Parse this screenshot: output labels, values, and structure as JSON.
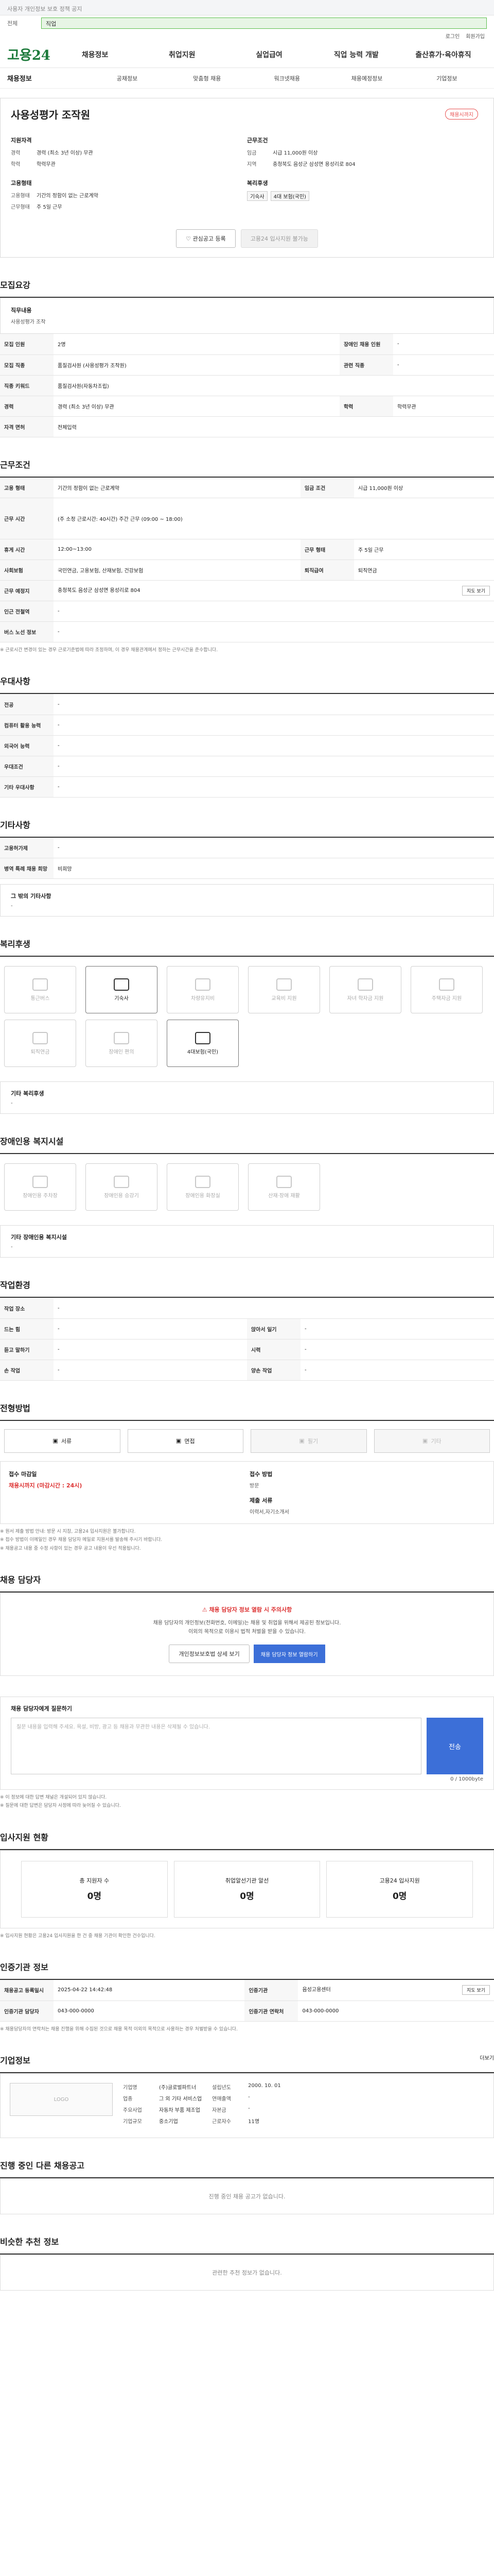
{
  "top": {
    "notice": "사용자 개인정보 보호 정책 공지",
    "search_scope": "전체",
    "search_placeholder": "직업",
    "util": [
      "로그인",
      "회원가입"
    ]
  },
  "gnb": {
    "logo": "고용24",
    "items": [
      "채용정보",
      "취업지원",
      "실업급여",
      "직업 능력 개발",
      "출산휴가·육아휴직"
    ]
  },
  "lnb": {
    "items": [
      "채용정보",
      "공채정보",
      "맞춤형 채용",
      "워크넷채용",
      "채용예정정보",
      "기업정보"
    ]
  },
  "summary": {
    "title": "사용성평가 조작원",
    "badge": "채용시까지",
    "col1_title": "지원자격",
    "col1": [
      {
        "k": "경력",
        "v": "경력 (최소 3년 이상) 무관"
      },
      {
        "k": "학력",
        "v": "학력무관"
      }
    ],
    "col2_title": "근무조건",
    "col2": [
      {
        "k": "임금",
        "v": "시급 11,000원 이상"
      },
      {
        "k": "지역",
        "v": "충청북도 음성군 삼성면 용성리로 804"
      }
    ],
    "col3_title": "고용형태",
    "col3": [
      {
        "k": "고용형태",
        "v": "기간의 정함이 없는 근로계약"
      },
      {
        "k": "근무형태",
        "v": "주 5일 근무"
      }
    ],
    "col4_title": "복리후생",
    "col4_tags": [
      "기숙사",
      "4대 보험(국민)"
    ],
    "btn_interest": "관심공고 등록",
    "btn_apply": "고용24 입사지원 불가능"
  },
  "s1": {
    "title": "모집요강",
    "job_label": "직무내용",
    "job_text": "사용성평가 조작"
  },
  "t1": [
    [
      "모집 인원",
      "2명",
      "장애인 채용 인원",
      "-"
    ],
    [
      "모집 직종",
      "품질검사원 (사용성평가 조작원)",
      "관련 직종",
      "-"
    ],
    [
      "직종 키워드",
      "품질검사원(자동차조립)",
      "",
      ""
    ],
    [
      "경력",
      "경력 (최소 3년 이상) 무관",
      "학력",
      "학력무관"
    ],
    [
      "자격 면허",
      "전체입력",
      "",
      ""
    ]
  ],
  "s2": {
    "title": "근무조건",
    "detail_btn": "지도 보기",
    "note": "※ 근로시간 변경이 있는 경우 근로기준법에 따라 조정하며, 이 경우 채용관계에서 정하는 근무시간을 준수합니다."
  },
  "t2": [
    [
      "고용 형태",
      "기간의 정함이 없는 근로계약",
      "임금 조건",
      "시급 11,000원 이상"
    ],
    [
      "근무 시간",
      "(주 소정 근로시간: 40시간) 주간 근무 (09:00 ~ 18:00)",
      "",
      ""
    ],
    [
      "휴게 시간",
      "12:00~13:00",
      "근무 형태",
      "주 5일 근무"
    ],
    [
      "사회보험",
      "국민연금, 고용보험, 산재보험, 건강보험",
      "퇴직급여",
      "퇴직연금"
    ],
    [
      "근무 예정지",
      "충청북도 음성군 삼성면 용성리로 804",
      "",
      ""
    ],
    [
      "인근 전철역",
      "-",
      "",
      ""
    ],
    [
      "버스 노선 정보",
      "-",
      "",
      ""
    ]
  ],
  "s3": {
    "title": "우대사항"
  },
  "t3": [
    [
      "전공",
      "-"
    ],
    [
      "컴퓨터 활용 능력",
      "-"
    ],
    [
      "외국어 능력",
      "-"
    ],
    [
      "우대조건",
      "-"
    ],
    [
      "기타 우대사항",
      "-"
    ]
  ],
  "s4": {
    "title": "기타사항"
  },
  "t4": [
    [
      "고용허가제",
      "-"
    ],
    [
      "병역 특례 채용 희망",
      "비희망"
    ]
  ],
  "s4b": {
    "label": "그 밖의 기타사항",
    "text": "-"
  },
  "s5": {
    "title": "복리후생",
    "icons": [
      {
        "label": "통근버스",
        "on": false
      },
      {
        "label": "기숙사",
        "on": true
      },
      {
        "label": "차량유지비",
        "on": false
      },
      {
        "label": "교육비 지원",
        "on": false
      },
      {
        "label": "자녀 학자금 지원",
        "on": false
      },
      {
        "label": "주택자금 지원",
        "on": false
      },
      {
        "label": "퇴직연금",
        "on": false
      },
      {
        "label": "장애인 편의",
        "on": false
      },
      {
        "label": "4대보험(국민)",
        "on": true
      }
    ],
    "etc_label": "기타 복리후생",
    "etc_text": "-"
  },
  "s6": {
    "title": "장애인용 복지시설",
    "icons": [
      "장애인용 주차장",
      "장애인용 승강기",
      "장애인용 화장실",
      "산재·장애 재활"
    ],
    "etc_label": "기타 장애인용 복지시설",
    "etc_text": "-"
  },
  "s7": {
    "title": "작업환경"
  },
  "t7": [
    [
      "작업 장소",
      "-",
      "",
      ""
    ],
    [
      "드는 힘",
      "-",
      "앉아서 일기",
      "-"
    ],
    [
      "듣고 말하기",
      "-",
      "시력",
      "-"
    ],
    [
      "손 작업",
      "-",
      "양손 작업",
      "-"
    ]
  ],
  "s8": {
    "title": "전형방법",
    "methods": [
      {
        "label": "서류",
        "on": true
      },
      {
        "label": "면접",
        "on": true
      },
      {
        "label": "필기",
        "on": false
      },
      {
        "label": "기타",
        "on": false
      }
    ],
    "deadline_label": "접수 마감일",
    "deadline": "채용시까지 (마감시간 : 24시)",
    "method_label": "접수 방법",
    "method_val": "방문",
    "docs_label": "제출 서류",
    "docs_val": "이력서,자기소개서",
    "notes": [
      "※ 원서 제출 방법 안내: 방문 시 지참, 고용24 입사지원은 불가합니다.",
      "※ 접수 방법이 이메일인 경우 채용 담당자 메일로 지원서를 발송해 주시기 바랍니다.",
      "※ 채용공고 내용 중 수정 사항이 있는 경우 공고 내용이 우선 적용됩니다."
    ]
  },
  "s9": {
    "title": "채용 담당자",
    "alert": "채용 담당자 정보 열람 시 주의사항",
    "p1": "채용 담당자의 개인정보(전화번호, 이메일)는 채용 및 취업을 위해서 제공된 정보입니다.",
    "p2": "이외의 목적으로 이용시 법적 처벌을 받을 수 있습니다.",
    "btn1": "개인정보보호법 상세 보기",
    "btn2": "채용 담당자 정보 열람하기"
  },
  "s10": {
    "title": "채용 담당자에게 질문하기",
    "count": "0 / 1000byte",
    "placeholder": "질문 내용을 입력해 주세요. 욕설, 비방, 광고 등 채용과 무관한 내용은 삭제될 수 있습니다.",
    "btn": "전송",
    "notes": [
      "※ 이 정보에 대한 답변 채널은 개설되어 있지 않습니다.",
      "※ 질문에 대한 답변은 담당자 사정에 따라 늦어질 수 있습니다."
    ]
  },
  "s11": {
    "title": "입사지원 현황",
    "stats": [
      {
        "label": "총 지원자 수",
        "n": "0명"
      },
      {
        "label": "취업알선기관 알선",
        "n": "0명"
      },
      {
        "label": "고용24 입사지원",
        "n": "0명"
      }
    ],
    "note": "※ 입사지원 현황은 고용24 입사지원을 한 건 중 채용 기관이 확인한 건수입니다."
  },
  "s12": {
    "title": "인증기관 정보",
    "btn": "지도 보기",
    "t": [
      [
        "채용공고 등록일시",
        "2025-04-22 14:42:48",
        "인증기관",
        "음성고용센터"
      ],
      [
        "인증기관 담당자",
        "043-000-0000",
        "인증기관 연락처",
        "043-000-0000"
      ]
    ],
    "note": "※ 채용담당자의 연락처는 채용 진행을 위해 수집된 것으로 채용 목적 이외의 목적으로 사용하는 경우 처벌받을 수 있습니다."
  },
  "s13": {
    "title": "기업정보",
    "logo": "LOGO",
    "more": "더보기",
    "rows_l": [
      [
        "기업명",
        "(주)글로벌파트너"
      ],
      [
        "업종",
        "그 외 기타 서비스업"
      ],
      [
        "주요사업",
        "자동차 부품 제조업"
      ],
      [
        "기업규모",
        "중소기업"
      ]
    ],
    "rows_r": [
      [
        "설립년도",
        "2000. 10. 01"
      ],
      [
        "연매출액",
        "-"
      ],
      [
        "자본금",
        "-"
      ],
      [
        "근로자수",
        "11명"
      ]
    ]
  },
  "s14": {
    "title": "진행 중인 다른 채용공고",
    "empty": "진행 중인 채용 공고가 없습니다."
  },
  "s15": {
    "title": "비슷한 추천 정보",
    "empty": "관련한 추천 정보가 없습니다."
  }
}
